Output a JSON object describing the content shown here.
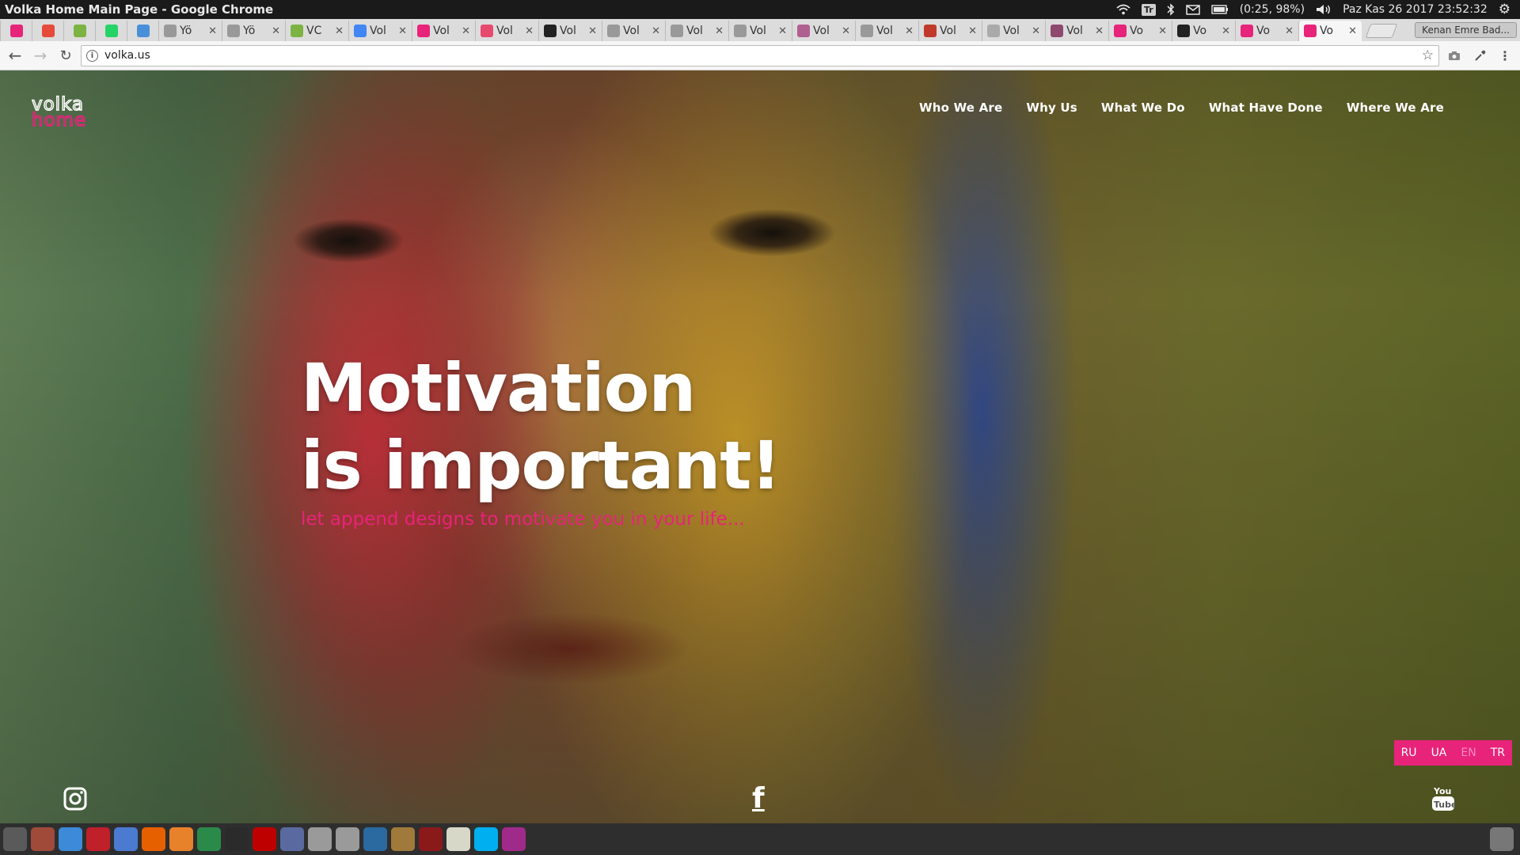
{
  "window": {
    "title": "Volka Home Main Page - Google Chrome"
  },
  "system_tray": {
    "keyboard_layout": "Tr",
    "battery": "(0:25, 98%)",
    "datetime": "Paz Kas 26 2017 23:52:32"
  },
  "tabs": [
    {
      "title": "",
      "icon": "pinned-volka-icon",
      "color": "#e8237a",
      "pinned": true
    },
    {
      "title": "",
      "icon": "pinned-gs-icon",
      "color": "#e64a3b",
      "pinned": true
    },
    {
      "title": "",
      "icon": "pinned-iki-icon",
      "color": "#7cb342",
      "pinned": true
    },
    {
      "title": "",
      "icon": "whatsapp-icon",
      "color": "#25d366",
      "pinned": true
    },
    {
      "title": "",
      "icon": "translate-icon",
      "color": "#4a90d9",
      "pinned": true
    },
    {
      "title": "Yö",
      "icon": "page-icon",
      "color": "#999999"
    },
    {
      "title": "Yö",
      "icon": "page-icon",
      "color": "#999999"
    },
    {
      "title": "VC",
      "icon": "iki-icon",
      "color": "#7cb342"
    },
    {
      "title": "Vol",
      "icon": "google-icon",
      "color": "#4285f4"
    },
    {
      "title": "Vol",
      "icon": "volka-icon",
      "color": "#e8237a"
    },
    {
      "title": "Vol",
      "icon": "heart-icon",
      "color": "#e64a6e"
    },
    {
      "title": "Vol",
      "icon": "dark-site-icon",
      "color": "#222222"
    },
    {
      "title": "Vol",
      "icon": "page-icon",
      "color": "#999999"
    },
    {
      "title": "Vol",
      "icon": "page-icon",
      "color": "#999999"
    },
    {
      "title": "Vol",
      "icon": "page-icon",
      "color": "#999999"
    },
    {
      "title": "Vol",
      "icon": "chevrons-icon",
      "color": "#b06090"
    },
    {
      "title": "Vol",
      "icon": "page-icon",
      "color": "#999999"
    },
    {
      "title": "Vol",
      "icon": "flag-icon",
      "color": "#c0392b"
    },
    {
      "title": "Vol",
      "icon": "dash-icon",
      "color": "#aaaaaa"
    },
    {
      "title": "Vol",
      "icon": "eye-icon",
      "color": "#8e4a6e"
    },
    {
      "title": "Vo",
      "icon": "volka-v-icon",
      "color": "#e8237a"
    },
    {
      "title": "Vo",
      "icon": "dark-site-icon",
      "color": "#222222"
    },
    {
      "title": "Vo",
      "icon": "volka-icon",
      "color": "#e8237a"
    },
    {
      "title": "Vo",
      "icon": "volka-v-icon",
      "color": "#e8237a",
      "active": true
    }
  ],
  "profile_button": "Kenan Emre Bad...",
  "address_bar": {
    "url": "volka.us"
  },
  "site": {
    "brand": {
      "line1": "volka",
      "line2": "home",
      "accent": "#e8237a"
    },
    "nav": [
      "Who We Are",
      "Why Us",
      "What We Do",
      "What Have Done",
      "Where We Are"
    ],
    "hero": {
      "line1": "Motivation",
      "line2": "is important!",
      "subtitle": "let append designs to motivate you in your life..."
    },
    "languages": [
      "RU",
      "UA",
      "EN",
      "TR"
    ],
    "current_language": "EN",
    "social": [
      "instagram-icon",
      "facebook-icon",
      "youtube-icon"
    ]
  },
  "dock_icons": [
    {
      "name": "dash-home-icon",
      "color": "#5a5a5a"
    },
    {
      "name": "files-icon",
      "color": "#a04a3a"
    },
    {
      "name": "chrome-icon",
      "color": "#3c8ad8"
    },
    {
      "name": "opera-icon",
      "color": "#c0202a"
    },
    {
      "name": "chromium-icon",
      "color": "#4a7bd0"
    },
    {
      "name": "firefox-icon",
      "color": "#e66000"
    },
    {
      "name": "settings-icon",
      "color": "#e8822a"
    },
    {
      "name": "remote-icon",
      "color": "#2a8a4a"
    },
    {
      "name": "terminal-icon",
      "color": "#2b2b2b"
    },
    {
      "name": "filezilla-icon",
      "color": "#bf0000"
    },
    {
      "name": "network-icon",
      "color": "#5a6aa0"
    },
    {
      "name": "drive-icon",
      "color": "#9a9a9a"
    },
    {
      "name": "drive2-icon",
      "color": "#9a9a9a"
    },
    {
      "name": "vpn-icon",
      "color": "#2a6aa0"
    },
    {
      "name": "archive-icon",
      "color": "#a07a3a"
    },
    {
      "name": "media-icon",
      "color": "#8a1a1a"
    },
    {
      "name": "editor-icon",
      "color": "#d8d8c8"
    },
    {
      "name": "skype-icon",
      "color": "#00aff0"
    },
    {
      "name": "app-icon",
      "color": "#a02a8a"
    }
  ]
}
